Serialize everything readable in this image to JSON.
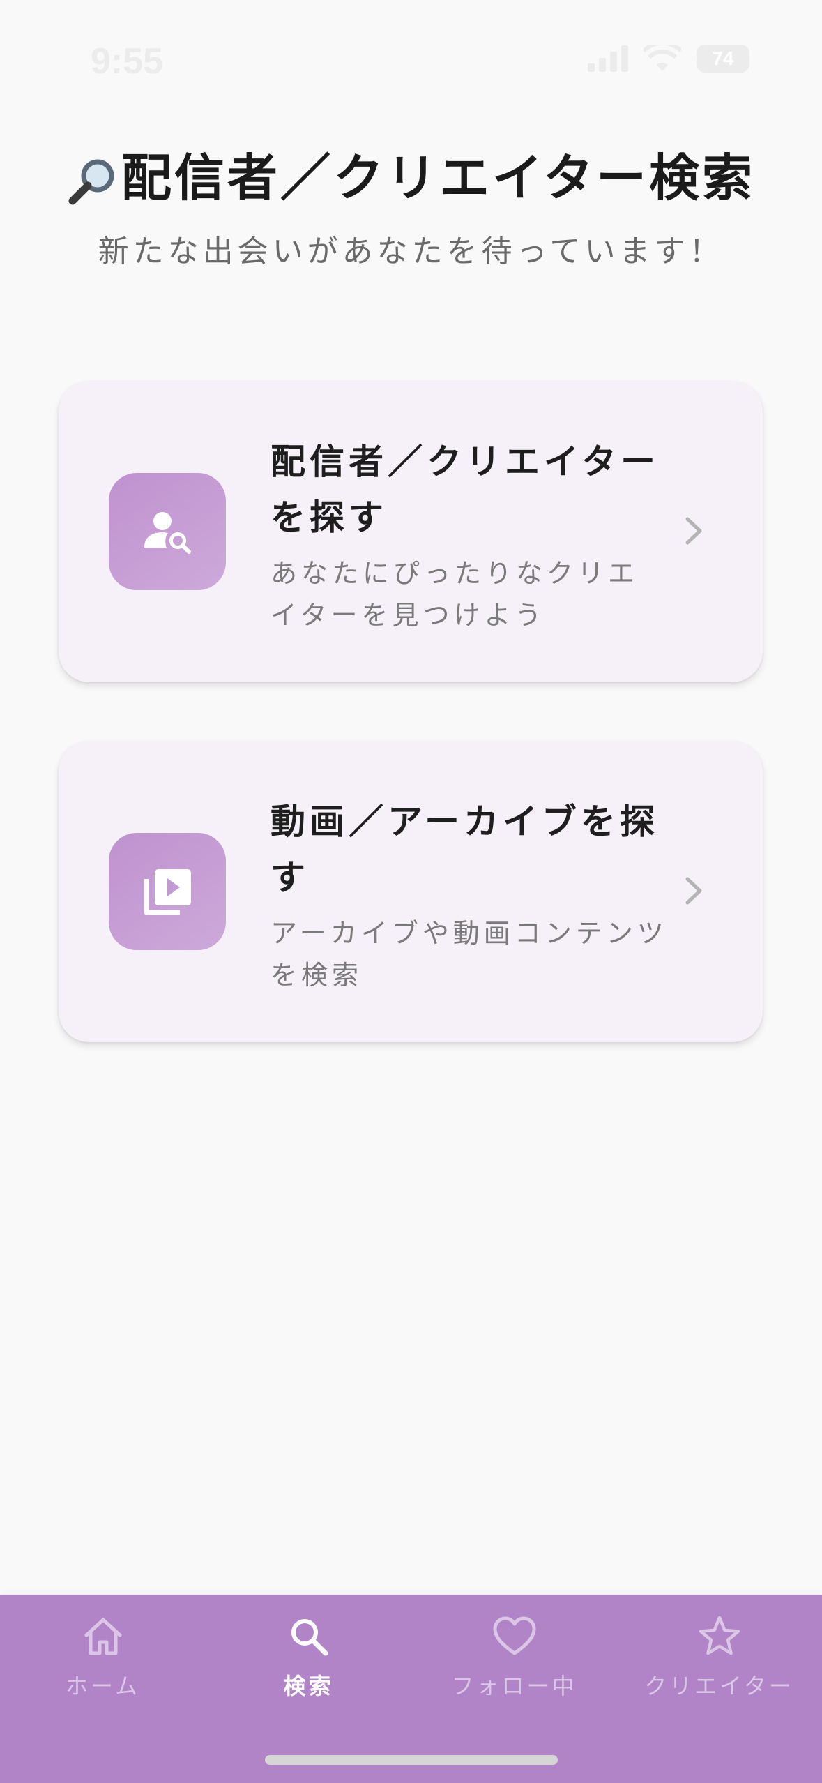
{
  "status_bar": {
    "time": "9:55",
    "battery": "74"
  },
  "header": {
    "title": "配信者／クリエイター検索",
    "subtitle": "新たな出会いがあなたを待っています！"
  },
  "cards": [
    {
      "title": "配信者／クリエイターを探す",
      "description": "あなたにぴったりなクリエイターを見つけよう",
      "icon": "person-search-icon"
    },
    {
      "title": "動画／アーカイブを探す",
      "description": "アーカイブや動画コンテンツを検索",
      "icon": "video-library-icon"
    }
  ],
  "bottom_nav": {
    "items": [
      {
        "label": "ホーム",
        "icon": "home-icon",
        "active": false
      },
      {
        "label": "検索",
        "icon": "search-icon",
        "active": true
      },
      {
        "label": "フォロー中",
        "icon": "heart-icon",
        "active": false
      },
      {
        "label": "クリエイター",
        "icon": "star-icon",
        "active": false
      }
    ]
  },
  "colors": {
    "background": "#f9f9f9",
    "card_background": "#f6f1f8",
    "accent": "#b184c8",
    "icon_tile": "#c39bd2",
    "nav_inactive": "#dcc6e7",
    "nav_active": "#ffffff"
  }
}
